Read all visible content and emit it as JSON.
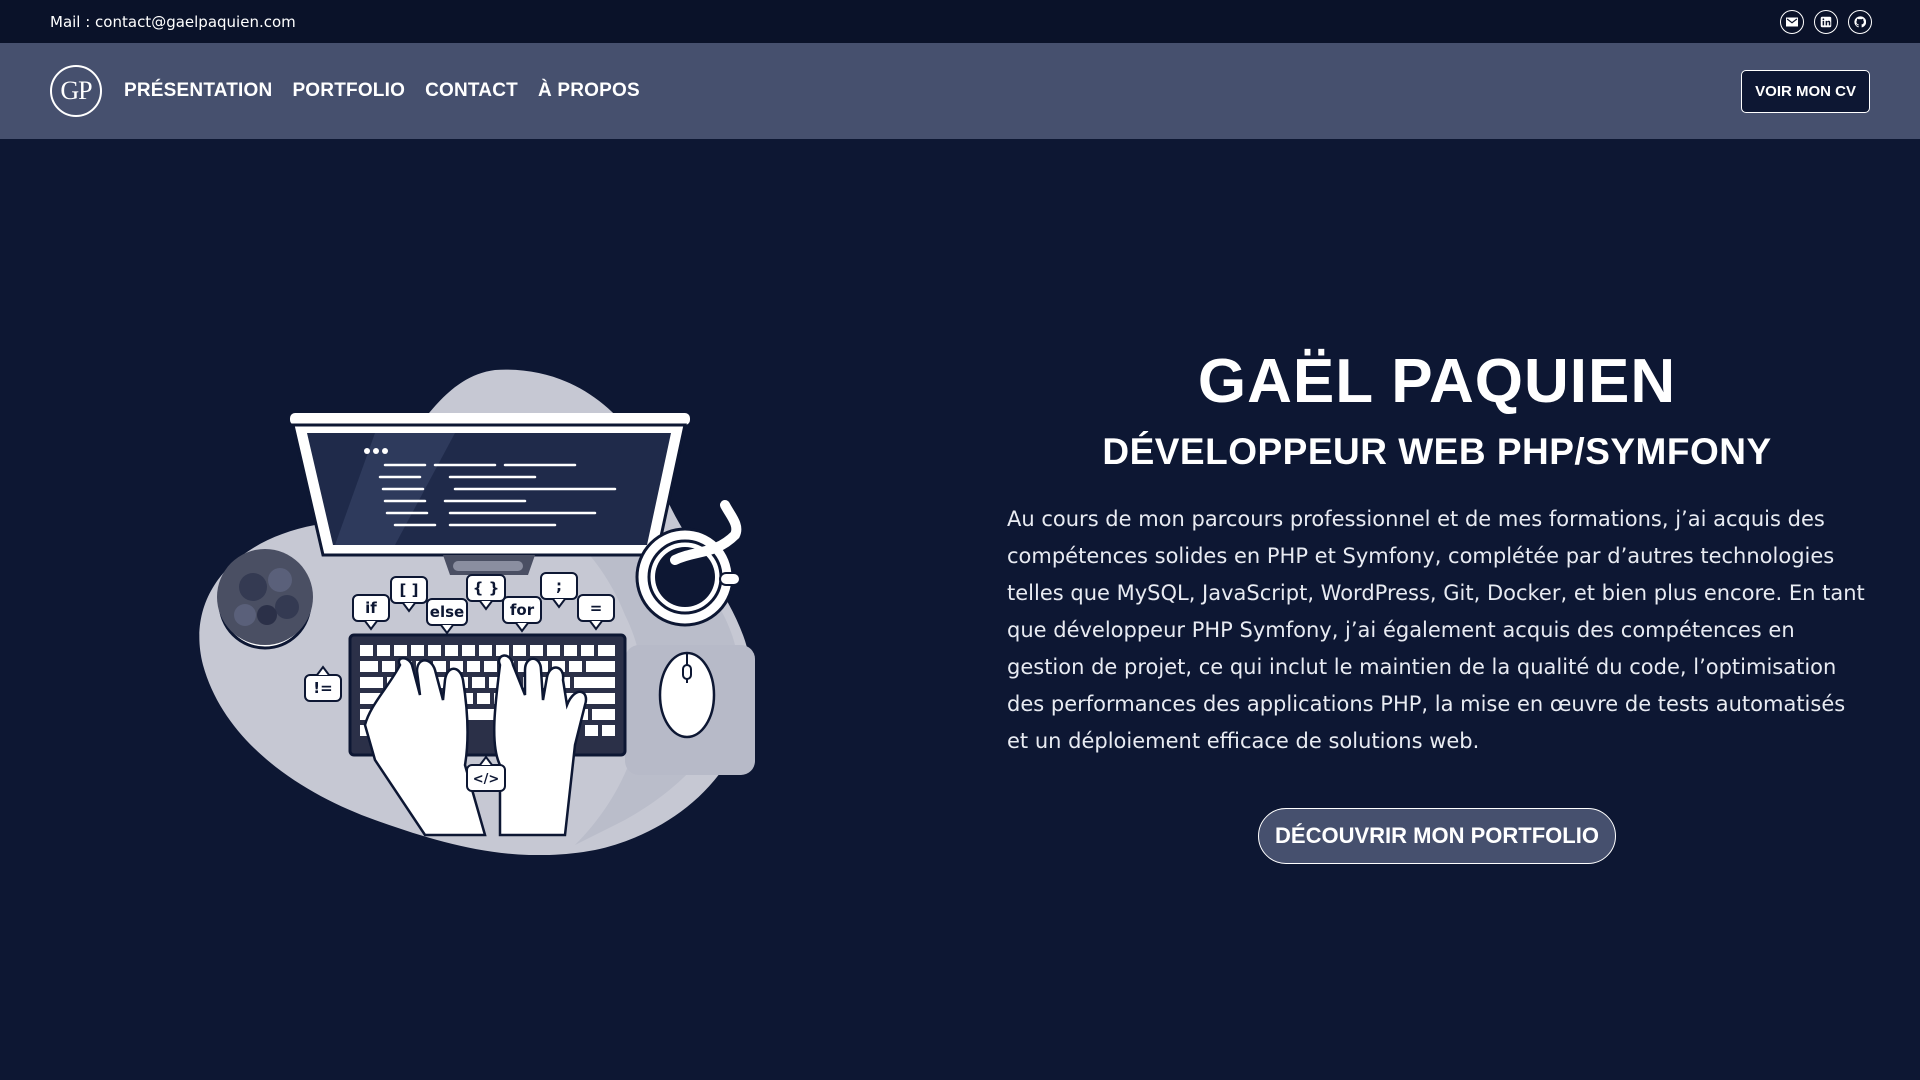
{
  "topbar": {
    "mail_text": "Mail : contact@gaelpaquien.com",
    "socials": [
      "mail-icon",
      "linkedin-icon",
      "github-icon"
    ]
  },
  "navbar": {
    "logo_text": "GP",
    "links": [
      "PRÉSENTATION",
      "PORTFOLIO",
      "CONTACT",
      "À PROPOS"
    ],
    "cv_button": "VOIR MON CV"
  },
  "hero": {
    "name": "GAËL PAQUIEN",
    "title": "DÉVELOPPEUR WEB PHP/SYMFONY",
    "description": "Au cours de mon parcours professionnel et de mes formations, j’ai acquis des compétences solides en PHP et Symfony, complétée par d’autres technologies telles que MySQL, JavaScript, WordPress, Git, Docker, et bien plus encore. En tant que développeur PHP Symfony, j’ai également acquis des compétences en gestion de projet, ce qui inclut le maintien de la qualité du code, l’optimisation des performances des applications PHP, la mise en œuvre de tests automatisés et un déploiement efficace de solutions web.",
    "portfolio_button": "DÉCOUVRIR MON PORTFOLIO",
    "bubbles": [
      "if",
      "[ ]",
      "else",
      "{ }",
      "for",
      ";",
      "=",
      "!=",
      "</>"
    ]
  },
  "colors": {
    "background": "#0d1733",
    "topbar": "#0a1229",
    "navbar": "#46506e",
    "text": "#ffffff"
  }
}
